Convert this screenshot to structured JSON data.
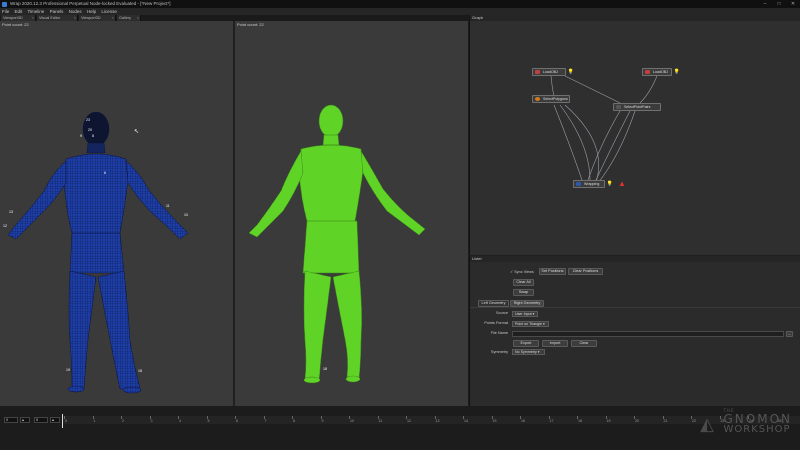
{
  "window": {
    "title": "Wrap 2020.12.3 Professional Perpetual Node-locked Evaluated - [*New Project*]"
  },
  "menu": [
    "File",
    "Edit",
    "Timeline",
    "Panels",
    "Nodes",
    "Help",
    "License"
  ],
  "tabs": [
    {
      "label": "Viewport3D"
    },
    {
      "label": "Visual Editor"
    },
    {
      "label": "Viewport3D"
    },
    {
      "label": "Gallery"
    }
  ],
  "viewports": {
    "left_label": "Point count: 22",
    "right_label": "Point count: 22"
  },
  "markers": {
    "left": [
      "23",
      "20",
      "9",
      "8",
      "13",
      "12",
      "11",
      "10",
      "6",
      "19",
      "18"
    ],
    "right": [
      "18"
    ]
  },
  "graph": {
    "title": "Graph",
    "nodes": {
      "load_a": "LoadOBJ",
      "load_b": "LoadOBJ",
      "select_polygons": "SelectPolygons",
      "select_points": "SelectPointPairs",
      "wrapping": "Wrapping"
    }
  },
  "lister": {
    "title": "Lister",
    "sync_views": "Sync Views",
    "set_positions": "Set Positions",
    "clear_positions": "Clear Positions",
    "clear_all": "Clear All",
    "swap": "Swap",
    "tab_left": "Left Geometry",
    "tab_right": "Right Geometry",
    "source_label": "Source",
    "source_value": "User Input",
    "points_format_label": "Points Format",
    "points_format_value": "Point on Triangle",
    "file_name_label": "File Name",
    "export": "Export",
    "import": "Import",
    "clear": "Clear",
    "symmetry_label": "Symmetry",
    "symmetry_value": "No Symmetry"
  },
  "timeline": {
    "start": "0",
    "end": "5",
    "ticks": [
      "0",
      "1",
      "2",
      "3",
      "4",
      "5",
      "6",
      "7",
      "8",
      "9",
      "10",
      "11",
      "12",
      "13",
      "14",
      "15",
      "16",
      "17",
      "18",
      "19",
      "20",
      "21",
      "22",
      "23",
      "24",
      "25"
    ]
  },
  "watermark": {
    "line1": "THE",
    "line2": "GNOMON",
    "line3": "WORKSHOP"
  },
  "colors": {
    "left_mesh": "#1e3fa8",
    "right_mesh": "#66e02a",
    "error_icon": "#e03030"
  }
}
